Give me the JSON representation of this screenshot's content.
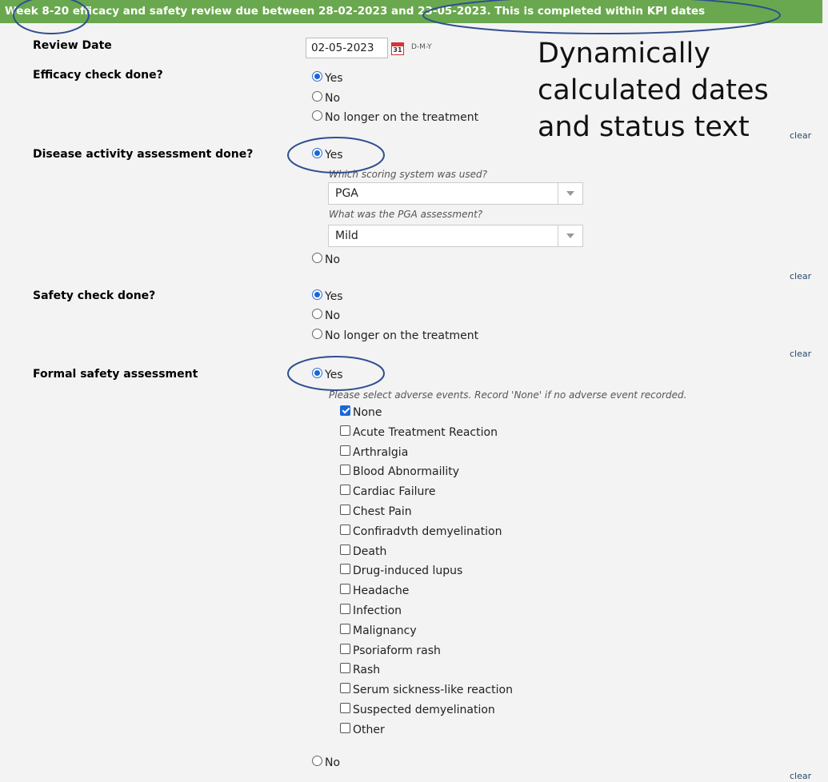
{
  "banner": {
    "text": "Week 8-20 efficacy and safety review due between 28-02-2023 and 23-05-2023. This is completed within KPI dates"
  },
  "review_date": {
    "label": "Review Date",
    "value": "02-05-2023",
    "format_hint": "D-M-Y",
    "calendar_day": "31"
  },
  "efficacy": {
    "label": "Efficacy check done?",
    "options": [
      "Yes",
      "No",
      "No longer on the treatment"
    ],
    "selected": "Yes"
  },
  "disease": {
    "label": "Disease activity assessment done?",
    "options": [
      "Yes",
      "No"
    ],
    "selected": "Yes",
    "scoring_question": "Which scoring system was used?",
    "scoring_value": "PGA",
    "pga_question": "What was the PGA assessment?",
    "pga_value": "Mild"
  },
  "safety": {
    "label": "Safety check done?",
    "options": [
      "Yes",
      "No",
      "No longer on the treatment"
    ],
    "selected": "Yes"
  },
  "formal": {
    "label": "Formal safety assessment",
    "options": [
      "Yes",
      "No"
    ],
    "selected": "Yes",
    "instruction": "Please select adverse events. Record 'None' if no adverse event recorded.",
    "events": [
      {
        "label": "None",
        "checked": true
      },
      {
        "label": "Acute Treatment Reaction",
        "checked": false
      },
      {
        "label": "Arthralgia",
        "checked": false
      },
      {
        "label": "Blood Abnormaility",
        "checked": false
      },
      {
        "label": "Cardiac Failure",
        "checked": false
      },
      {
        "label": "Chest Pain",
        "checked": false
      },
      {
        "label": "Confiradvth demyelination",
        "checked": false
      },
      {
        "label": "Death",
        "checked": false
      },
      {
        "label": "Drug-induced lupus",
        "checked": false
      },
      {
        "label": "Headache",
        "checked": false
      },
      {
        "label": "Infection",
        "checked": false
      },
      {
        "label": "Malignancy",
        "checked": false
      },
      {
        "label": "Psoriaform rash",
        "checked": false
      },
      {
        "label": "Rash",
        "checked": false
      },
      {
        "label": "Serum sickness-like reaction",
        "checked": false
      },
      {
        "label": "Suspected demyelination",
        "checked": false
      },
      {
        "label": "Other",
        "checked": false
      }
    ]
  },
  "clear_label": "clear",
  "annotation": {
    "lines": [
      "Dynamically",
      "calculated dates",
      "and status text"
    ]
  },
  "colors": {
    "banner": "#6aa84f",
    "accent": "#1a66d8",
    "annotation_outline": "#2f4f8f"
  }
}
